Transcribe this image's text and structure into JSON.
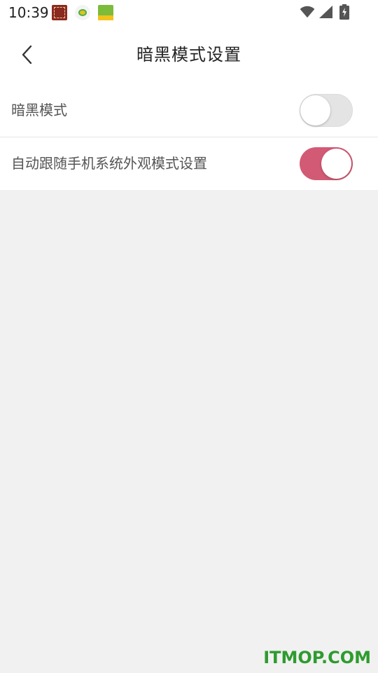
{
  "status_bar": {
    "time": "10:39",
    "app_icons": [
      "app-icon-1",
      "app-icon-2",
      "app-icon-3"
    ],
    "indicators": [
      "wifi-icon",
      "signal-icon",
      "battery-charging-icon"
    ]
  },
  "toolbar": {
    "back_icon": "chevron-left-icon",
    "title": "暗黑模式设置"
  },
  "settings": [
    {
      "label": "暗黑模式",
      "enabled": false
    },
    {
      "label": "自动跟随手机系统外观模式设置",
      "enabled": true
    }
  ],
  "colors": {
    "toggle_on": "#d25a74",
    "toggle_off": "#e4e4e4",
    "background": "#f1f1f1"
  },
  "watermark": "ITMOP.COM"
}
